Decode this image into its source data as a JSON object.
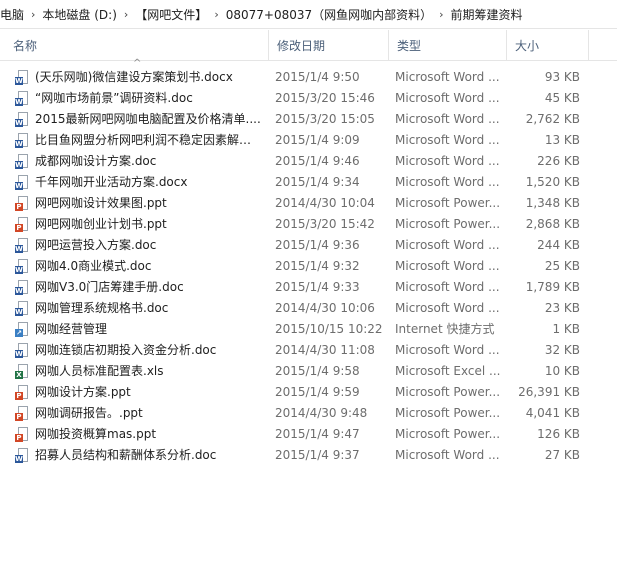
{
  "breadcrumb": [
    "电脑",
    "本地磁盘 (D:)",
    "【网吧文件】",
    "08077+08037（网鱼网咖内部资料）",
    "前期筹建资料"
  ],
  "header": {
    "name": "名称",
    "date": "修改日期",
    "type": "类型",
    "size": "大小"
  },
  "colors": {
    "word": "#2b579a",
    "powerpoint": "#d24726",
    "excel": "#217346",
    "shortcut": "#3a7fc4"
  },
  "files": [
    {
      "name": "(天乐网咖)微信建设方案策划书.docx",
      "date": "2015/1/4 9:50",
      "type": "Microsoft Word ...",
      "size": "93 KB",
      "icon": "word-icon"
    },
    {
      "name": "“网咖市场前景”调研资料.doc",
      "date": "2015/3/20 15:46",
      "type": "Microsoft Word ...",
      "size": "45 KB",
      "icon": "word-icon"
    },
    {
      "name": "2015最新网吧网咖电脑配置及价格清单....",
      "date": "2015/3/20 15:05",
      "type": "Microsoft Word ...",
      "size": "2,762 KB",
      "icon": "word-icon"
    },
    {
      "name": "比目鱼网盟分析网吧利润不稳定因素解析....",
      "date": "2015/1/4 9:09",
      "type": "Microsoft Word ...",
      "size": "13 KB",
      "icon": "word-icon"
    },
    {
      "name": "成都网咖设计方案.doc",
      "date": "2015/1/4 9:46",
      "type": "Microsoft Word ...",
      "size": "226 KB",
      "icon": "word-icon"
    },
    {
      "name": "千年网咖开业活动方案.docx",
      "date": "2015/1/4 9:34",
      "type": "Microsoft Word ...",
      "size": "1,520 KB",
      "icon": "word-icon"
    },
    {
      "name": "网吧网咖设计效果图.ppt",
      "date": "2014/4/30 10:04",
      "type": "Microsoft Power...",
      "size": "1,348 KB",
      "icon": "powerpoint-icon"
    },
    {
      "name": "网吧网咖创业计划书.ppt",
      "date": "2015/3/20 15:42",
      "type": "Microsoft Power...",
      "size": "2,868 KB",
      "icon": "powerpoint-icon"
    },
    {
      "name": "网吧运营投入方案.doc",
      "date": "2015/1/4 9:36",
      "type": "Microsoft Word ...",
      "size": "244 KB",
      "icon": "word-icon"
    },
    {
      "name": "网咖4.0商业模式.doc",
      "date": "2015/1/4 9:32",
      "type": "Microsoft Word ...",
      "size": "25 KB",
      "icon": "word-icon"
    },
    {
      "name": "网咖V3.0门店筹建手册.doc",
      "date": "2015/1/4 9:33",
      "type": "Microsoft Word ...",
      "size": "1,789 KB",
      "icon": "word-icon"
    },
    {
      "name": "网咖管理系统规格书.doc",
      "date": "2014/4/30 10:06",
      "type": "Microsoft Word ...",
      "size": "23 KB",
      "icon": "word-icon"
    },
    {
      "name": "网咖经营管理",
      "date": "2015/10/15 10:22",
      "type": "Internet 快捷方式",
      "size": "1 KB",
      "icon": "shortcut-icon"
    },
    {
      "name": "网咖连锁店初期投入资金分析.doc",
      "date": "2014/4/30 11:08",
      "type": "Microsoft Word ...",
      "size": "32 KB",
      "icon": "word-icon"
    },
    {
      "name": "网咖人员标准配置表.xls",
      "date": "2015/1/4 9:58",
      "type": "Microsoft Excel ...",
      "size": "10 KB",
      "icon": "excel-icon"
    },
    {
      "name": "网咖设计方案.ppt",
      "date": "2015/1/4 9:59",
      "type": "Microsoft Power...",
      "size": "26,391 KB",
      "icon": "powerpoint-icon"
    },
    {
      "name": "网咖调研报告。.ppt",
      "date": "2014/4/30 9:48",
      "type": "Microsoft Power...",
      "size": "4,041 KB",
      "icon": "powerpoint-icon"
    },
    {
      "name": "网咖投资概算mas.ppt",
      "date": "2015/1/4 9:47",
      "type": "Microsoft Power...",
      "size": "126 KB",
      "icon": "powerpoint-icon"
    },
    {
      "name": "招募人员结构和薪酬体系分析.doc",
      "date": "2015/1/4 9:37",
      "type": "Microsoft Word ...",
      "size": "27 KB",
      "icon": "word-icon"
    }
  ]
}
